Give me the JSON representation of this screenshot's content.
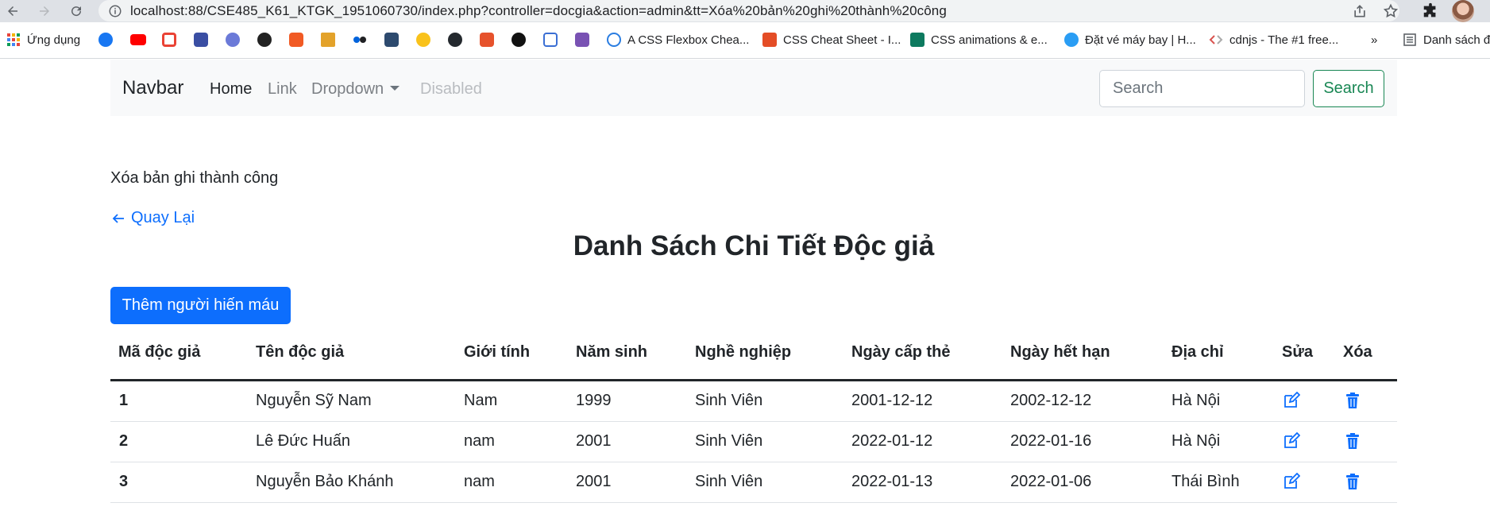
{
  "browser": {
    "url": "localhost:88/CSE485_K61_KTGK_1951060730/index.php?controller=docgia&action=admin&tt=Xóa%20bản%20ghi%20thành%20công",
    "bookmarks": [
      {
        "label": "Ứng dụng",
        "icon": "apps-grid-icon"
      },
      {
        "label": "A CSS Flexbox Chea...",
        "icon": "flexbox-icon"
      },
      {
        "label": "CSS Cheat Sheet - I...",
        "icon": "html5-icon"
      },
      {
        "label": "CSS animations & e...",
        "icon": "css-animations-icon"
      },
      {
        "label": "Đặt vé máy bay | H...",
        "icon": "flight-icon"
      },
      {
        "label": "cdnjs - The #1 free...",
        "icon": "cdnjs-icon"
      },
      {
        "label": "»",
        "icon": "more-bookmarks-icon"
      },
      {
        "label": "Danh sách đ",
        "icon": "reading-list-icon"
      }
    ]
  },
  "navbar": {
    "brand": "Navbar",
    "links": [
      "Home",
      "Link",
      "Dropdown",
      "Disabled"
    ],
    "search_placeholder": "Search",
    "search_button": "Search"
  },
  "page": {
    "message": "Xóa bản ghi thành công",
    "back_link": "Quay Lại",
    "title": "Danh Sách Chi Tiết Độc giả",
    "add_button": "Thêm người hiến máu"
  },
  "table": {
    "headers": [
      "Mã độc giả",
      "Tên độc giả",
      "Giới tính",
      "Năm sinh",
      "Nghề nghiệp",
      "Ngày cấp thẻ",
      "Ngày hết hạn",
      "Địa chỉ",
      "Sửa",
      "Xóa"
    ],
    "rows": [
      [
        "1",
        "Nguyễn Sỹ Nam",
        "Nam",
        "1999",
        "Sinh Viên",
        "2001-12-12",
        "2002-12-12",
        "Hà Nội"
      ],
      [
        "2",
        "Lê Đức Huấn",
        "nam",
        "2001",
        "Sinh Viên",
        "2022-01-12",
        "2022-01-16",
        "Hà Nội"
      ],
      [
        "3",
        "Nguyễn Bảo Khánh",
        "nam",
        "2001",
        "Sinh Viên",
        "2022-01-13",
        "2022-01-06",
        "Thái Bình"
      ]
    ]
  },
  "colors": {
    "primary": "#0d6efd",
    "success": "#198754",
    "navbar_bg": "#f8f9fa"
  }
}
